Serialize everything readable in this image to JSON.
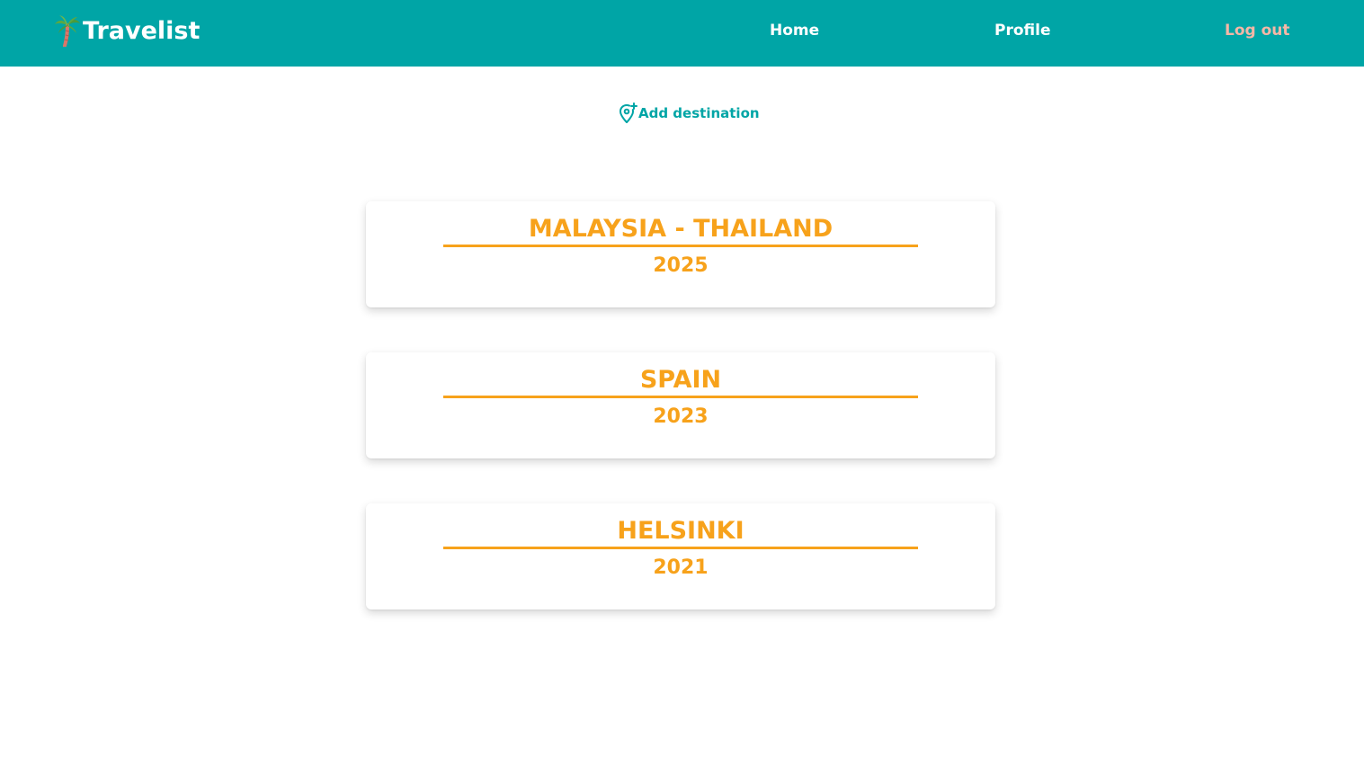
{
  "nav": {
    "brand": "Travelist",
    "home": "Home",
    "profile": "Profile",
    "logout": "Log out"
  },
  "actions": {
    "add_destination": "Add destination"
  },
  "destinations": [
    {
      "name": "MALAYSIA - THAILAND",
      "year": "2025"
    },
    {
      "name": "SPAIN",
      "year": "2023"
    },
    {
      "name": "HELSINKI",
      "year": "2021"
    }
  ],
  "colors": {
    "navbar": "#00a5a6",
    "accent": "#f7a21b",
    "logout": "#f6b7a6"
  },
  "icons": {
    "brand": "palm-tree-icon",
    "add": "map-pin-plus-icon"
  }
}
